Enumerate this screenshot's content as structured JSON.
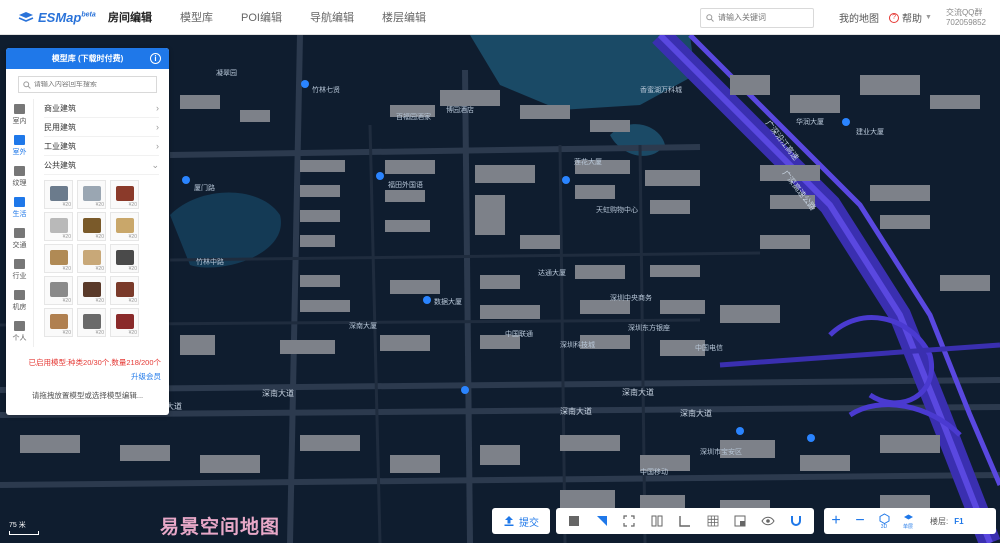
{
  "app": {
    "logo_text": "ESMap",
    "logo_sup": "beta"
  },
  "nav": {
    "items": [
      {
        "label": "房间编辑",
        "active": true
      },
      {
        "label": "模型库",
        "active": false
      },
      {
        "label": "POI编辑",
        "active": false
      },
      {
        "label": "导航编辑",
        "active": false
      },
      {
        "label": "楼层编辑",
        "active": false
      }
    ]
  },
  "header_right": {
    "search_placeholder": "请输入关键词",
    "my_map": "我的地图",
    "help": "帮助",
    "qq_line1": "交流QQ群",
    "qq_line2": "702059852"
  },
  "panel": {
    "title": "模型库 (下载时付费)",
    "search_placeholder": "请输入内容回车搜索",
    "side_tabs": [
      {
        "label": "室内",
        "active": false
      },
      {
        "label": "室外",
        "active": true
      },
      {
        "label": "纹理",
        "active": false
      },
      {
        "label": "生活",
        "active": true
      },
      {
        "label": "交通",
        "active": false
      },
      {
        "label": "行业",
        "active": false
      },
      {
        "label": "机房",
        "active": false
      },
      {
        "label": "个人",
        "active": false
      }
    ],
    "categories": [
      {
        "label": "商业建筑",
        "arrow": "›"
      },
      {
        "label": "民用建筑",
        "arrow": "›"
      },
      {
        "label": "工业建筑",
        "arrow": "›"
      },
      {
        "label": "公共建筑",
        "arrow": "⌄"
      }
    ],
    "thumbnails": [
      {
        "price": "¥20",
        "color": "#6b7b8c"
      },
      {
        "price": "¥20",
        "color": "#9aa6b2"
      },
      {
        "price": "¥20",
        "color": "#8b3a2a"
      },
      {
        "price": "¥20",
        "color": "#b9b9b9"
      },
      {
        "price": "¥20",
        "color": "#7a5a2a"
      },
      {
        "price": "¥20",
        "color": "#c9a76a"
      },
      {
        "price": "¥20",
        "color": "#b08a55"
      },
      {
        "price": "¥20",
        "color": "#c8a878"
      },
      {
        "price": "¥20",
        "color": "#4a4a4a"
      },
      {
        "price": "¥20",
        "color": "#8a8a8a"
      },
      {
        "price": "¥20",
        "color": "#5a3a2a"
      },
      {
        "price": "¥20",
        "color": "#7a3a2a"
      },
      {
        "price": "¥20",
        "color": "#b08050"
      },
      {
        "price": "¥20",
        "color": "#6a6a6a"
      },
      {
        "price": "¥20",
        "color": "#8a2a2a"
      }
    ],
    "usage": "已启用模型:种类20/30个,数量218/200个",
    "upgrade": "升级会员",
    "hint": "请拖拽放置模型或选择模型编辑..."
  },
  "map": {
    "road_labels": [
      {
        "text": "深南大道"
      },
      {
        "text": "深南大道"
      },
      {
        "text": "深南大道"
      },
      {
        "text": "深南大道"
      },
      {
        "text": "深南大道"
      },
      {
        "text": "广深沿江高速"
      },
      {
        "text": "广深高速公路"
      }
    ],
    "poi_labels": [
      {
        "text": "凝翠园"
      },
      {
        "text": "竹林七贤"
      },
      {
        "text": "百福园酒家"
      },
      {
        "text": "博园酒店"
      },
      {
        "text": "福田外国语"
      },
      {
        "text": "厦门路"
      },
      {
        "text": "莲花大厦"
      },
      {
        "text": "香蜜湖万科城"
      },
      {
        "text": "天虹购物中心"
      },
      {
        "text": "竹林中路"
      },
      {
        "text": "深南大厦"
      },
      {
        "text": "数据大厦"
      },
      {
        "text": "中国联通"
      },
      {
        "text": "深圳科技城"
      },
      {
        "text": "深圳东方银座"
      },
      {
        "text": "深圳中央商务"
      },
      {
        "text": "中国电信"
      },
      {
        "text": "深圳市宝安区"
      },
      {
        "text": "建业大厦"
      },
      {
        "text": "华润大厦"
      },
      {
        "text": "中国移动"
      },
      {
        "text": "达通大厦"
      }
    ]
  },
  "toolbar": {
    "submit": "提交",
    "floor_label": "楼层:",
    "floor_value": "F1",
    "view_3d": "3D",
    "view_single": "单层"
  },
  "watermark": "易景空间地图",
  "scale": "75 米"
}
